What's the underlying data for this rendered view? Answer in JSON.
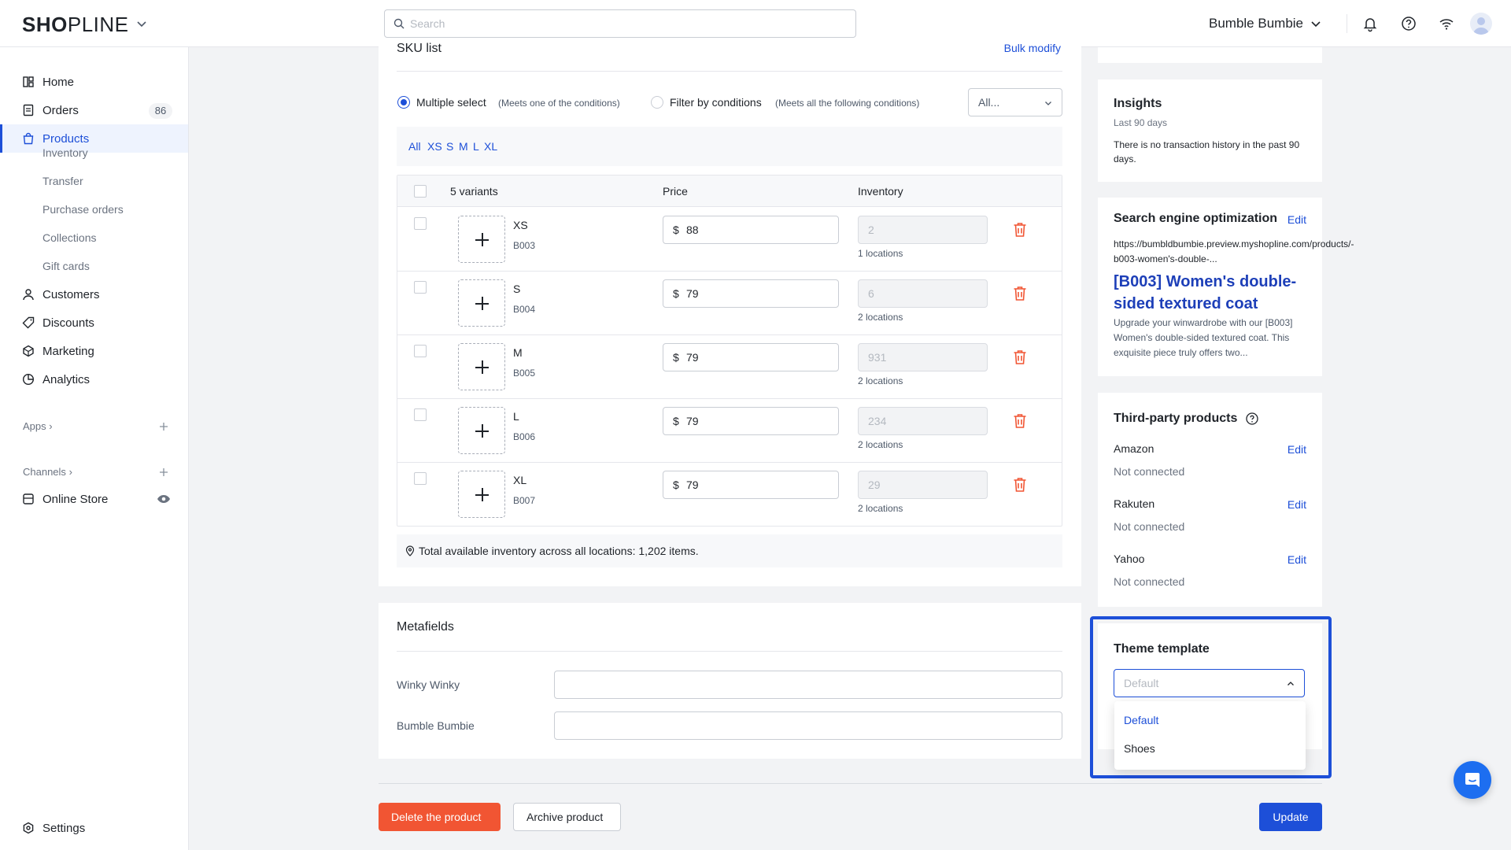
{
  "brand": {
    "logo_bold": "SH",
    "logo_mid": "O",
    "logo_rest": "PLINE"
  },
  "search": {
    "placeholder": "Search"
  },
  "header": {
    "store_name": "Bumble Bumbie"
  },
  "sidebar": {
    "home": "Home",
    "orders": "Orders",
    "orders_badge": "86",
    "products": "Products",
    "sub": [
      "Inventory",
      "Transfer",
      "Purchase orders",
      "Collections",
      "Gift cards"
    ],
    "customers": "Customers",
    "discounts": "Discounts",
    "marketing": "Marketing",
    "analytics": "Analytics",
    "apps": "Apps",
    "channels": "Channels",
    "online_store": "Online Store",
    "settings": "Settings"
  },
  "sku": {
    "title": "SKU list",
    "bulk_modify": "Bulk modify",
    "multiple_select": "Multiple select",
    "multiple_hint": "(Meets one of the conditions)",
    "filter_conditions": "Filter by conditions",
    "filter_hint": "(Meets all the following conditions)",
    "select_value": "All...",
    "chips": [
      "All",
      "XS",
      "S",
      "M",
      "L",
      "XL"
    ],
    "col_variants": "5 variants",
    "col_price": "Price",
    "col_inventory": "Inventory",
    "currency": "$",
    "rows": [
      {
        "name": "XS",
        "sku": "B003",
        "price": "88",
        "inventory": "2",
        "locations": "1 locations"
      },
      {
        "name": "S",
        "sku": "B004",
        "price": "79",
        "inventory": "6",
        "locations": "2 locations"
      },
      {
        "name": "M",
        "sku": "B005",
        "price": "79",
        "inventory": "931",
        "locations": "2 locations"
      },
      {
        "name": "L",
        "sku": "B006",
        "price": "79",
        "inventory": "234",
        "locations": "2 locations"
      },
      {
        "name": "XL",
        "sku": "B007",
        "price": "79",
        "inventory": "29",
        "locations": "2 locations"
      }
    ],
    "total": "Total available inventory across all locations: 1,202 items."
  },
  "metafields": {
    "title": "Metafields",
    "fields": [
      {
        "label": "Winky Winky",
        "value": ""
      },
      {
        "label": "Bumble Bumbie",
        "value": ""
      }
    ]
  },
  "actions": {
    "delete": "Delete the product",
    "archive": "Archive product",
    "update": "Update"
  },
  "insights": {
    "title": "Insights",
    "period": "Last 90 days",
    "message": "There is no transaction history in the past 90 days."
  },
  "seo": {
    "title": "Search engine optimization",
    "edit": "Edit",
    "url": "https://bumbldbumbie.preview.myshopline.com/products/-b003-women's-double-...",
    "page_title": "[B003] Women's double-sided textured coat",
    "description": "Upgrade your winwardrobe with our [B003] Women's double-sided textured coat. This exquisite piece truly offers two..."
  },
  "third_party": {
    "title": "Third-party products",
    "edit": "Edit",
    "items": [
      {
        "name": "Amazon",
        "status": "Not connected"
      },
      {
        "name": "Rakuten",
        "status": "Not connected"
      },
      {
        "name": "Yahoo",
        "status": "Not connected"
      }
    ]
  },
  "theme": {
    "title": "Theme template",
    "placeholder": "Default",
    "options": [
      "Default",
      "Shoes"
    ],
    "selected": "Default"
  },
  "colors": {
    "accent": "#1d4fd8",
    "danger": "#f15533",
    "focus_frame": "#1d4fd8"
  }
}
